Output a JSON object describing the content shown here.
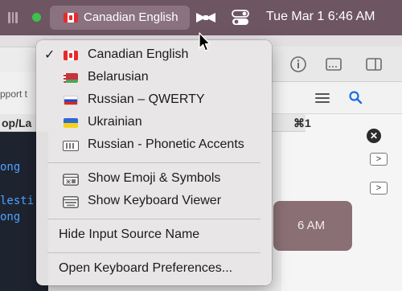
{
  "menubar": {
    "input_source_label": "Canadian English",
    "datetime": "Tue Mar 1  6:46 AM"
  },
  "menu": {
    "sources": [
      {
        "label": "Canadian English",
        "checked": true,
        "icon": "flag-canada"
      },
      {
        "label": "Belarusian",
        "checked": false,
        "icon": "flag-belarus"
      },
      {
        "label": "Russian – QWERTY",
        "checked": false,
        "icon": "flag-russia"
      },
      {
        "label": "Ukrainian",
        "checked": false,
        "icon": "flag-ukraine"
      },
      {
        "label": "Russian - Phonetic Accents",
        "checked": false,
        "icon": "keyboard-icon"
      }
    ],
    "check_glyph": "✓",
    "show_emoji": "Show Emoji & Symbols",
    "show_keyboard_viewer": "Show Keyboard Viewer",
    "hide_input_source_name": "Hide Input Source Name",
    "open_keyboard_prefs": "Open Keyboard Preferences..."
  },
  "background": {
    "left_snippet": "pport t",
    "left_header": "op/La",
    "shortcut": "⌘1",
    "terminal_lines": [
      "ong",
      "lesti",
      "ong"
    ],
    "notification_time": "6 AM",
    "close_glyph": "✕",
    "box_glyph": ">"
  },
  "colors": {
    "menubar": "#6e5562",
    "menu_bg": "#e8e5e6",
    "terminal_text": "#4da3ff"
  }
}
